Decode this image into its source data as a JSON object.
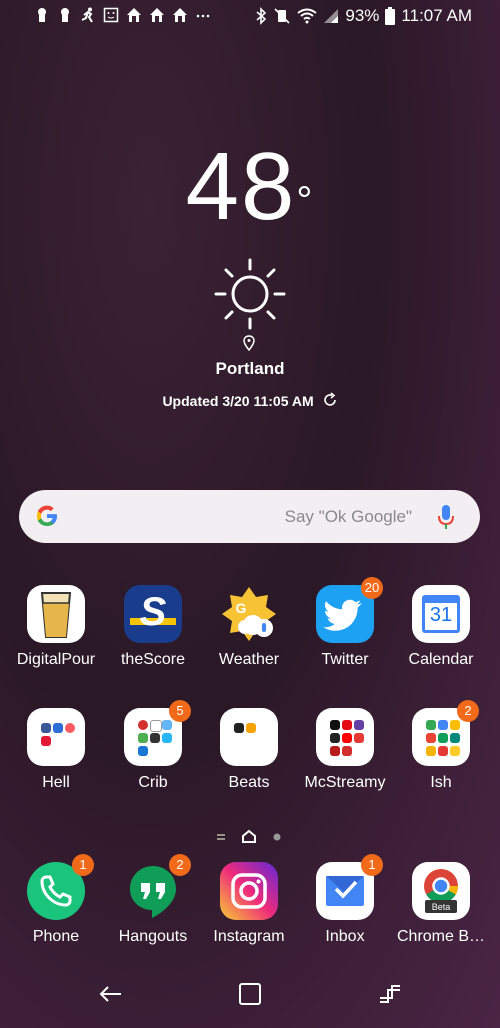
{
  "status_bar": {
    "battery": "93%",
    "time": "11:07 AM"
  },
  "weather": {
    "temperature": "48",
    "degree": "°",
    "location": "Portland",
    "updated": "Updated 3/20 11:05 AM"
  },
  "search": {
    "placeholder": "Say \"Ok Google\""
  },
  "apps_row1": [
    {
      "label": "DigitalPour",
      "badge": ""
    },
    {
      "label": "theScore",
      "badge": ""
    },
    {
      "label": "Weather",
      "badge": ""
    },
    {
      "label": "Twitter",
      "badge": "20"
    },
    {
      "label": "Calendar",
      "badge": ""
    }
  ],
  "apps_row2": [
    {
      "label": "Hell",
      "badge": ""
    },
    {
      "label": "Crib",
      "badge": "5"
    },
    {
      "label": "Beats",
      "badge": ""
    },
    {
      "label": "McStreamy",
      "badge": ""
    },
    {
      "label": "Ish",
      "badge": "2"
    }
  ],
  "dock": [
    {
      "label": "Phone",
      "badge": "1"
    },
    {
      "label": "Hangouts",
      "badge": "2"
    },
    {
      "label": "Instagram",
      "badge": ""
    },
    {
      "label": "Inbox",
      "badge": "1"
    },
    {
      "label": "Chrome B…",
      "badge": ""
    }
  ],
  "calendar_day": "31",
  "chrome_beta_tag": "Beta",
  "colors": {
    "badge": "#f06a1a",
    "search_bg": "#f2eef2"
  }
}
